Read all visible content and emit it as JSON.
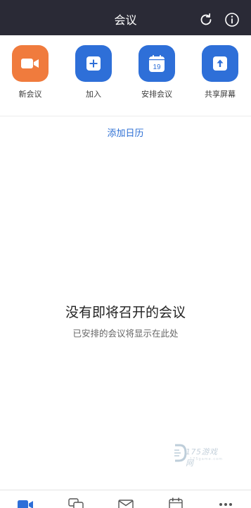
{
  "header": {
    "title": "会议"
  },
  "actions": [
    {
      "label": "新会议",
      "icon": "video-camera-icon",
      "color": "#f07b3d"
    },
    {
      "label": "加入",
      "icon": "plus-icon",
      "color": "#2e6fd8"
    },
    {
      "label": "安排会议",
      "icon": "calendar-icon",
      "color": "#2e6fd8",
      "icon_text": "19"
    },
    {
      "label": "共享屏幕",
      "icon": "upload-arrow-icon",
      "color": "#2e6fd8"
    }
  ],
  "add_calendar": "添加日历",
  "empty_state": {
    "title": "没有即将召开的会议",
    "subtitle": "已安排的会议将显示在此处"
  },
  "watermark": {
    "text": "175游戏网",
    "sub": "175game.com"
  },
  "tabbar": {
    "items": [
      {
        "icon": "video-icon",
        "active": true
      },
      {
        "icon": "chat-icon",
        "active": false
      },
      {
        "icon": "mail-icon",
        "active": false
      },
      {
        "icon": "calendar-icon",
        "active": false
      },
      {
        "icon": "more-icon",
        "active": false
      }
    ],
    "active_color": "#2e6fd8",
    "inactive_color": "#555555"
  }
}
